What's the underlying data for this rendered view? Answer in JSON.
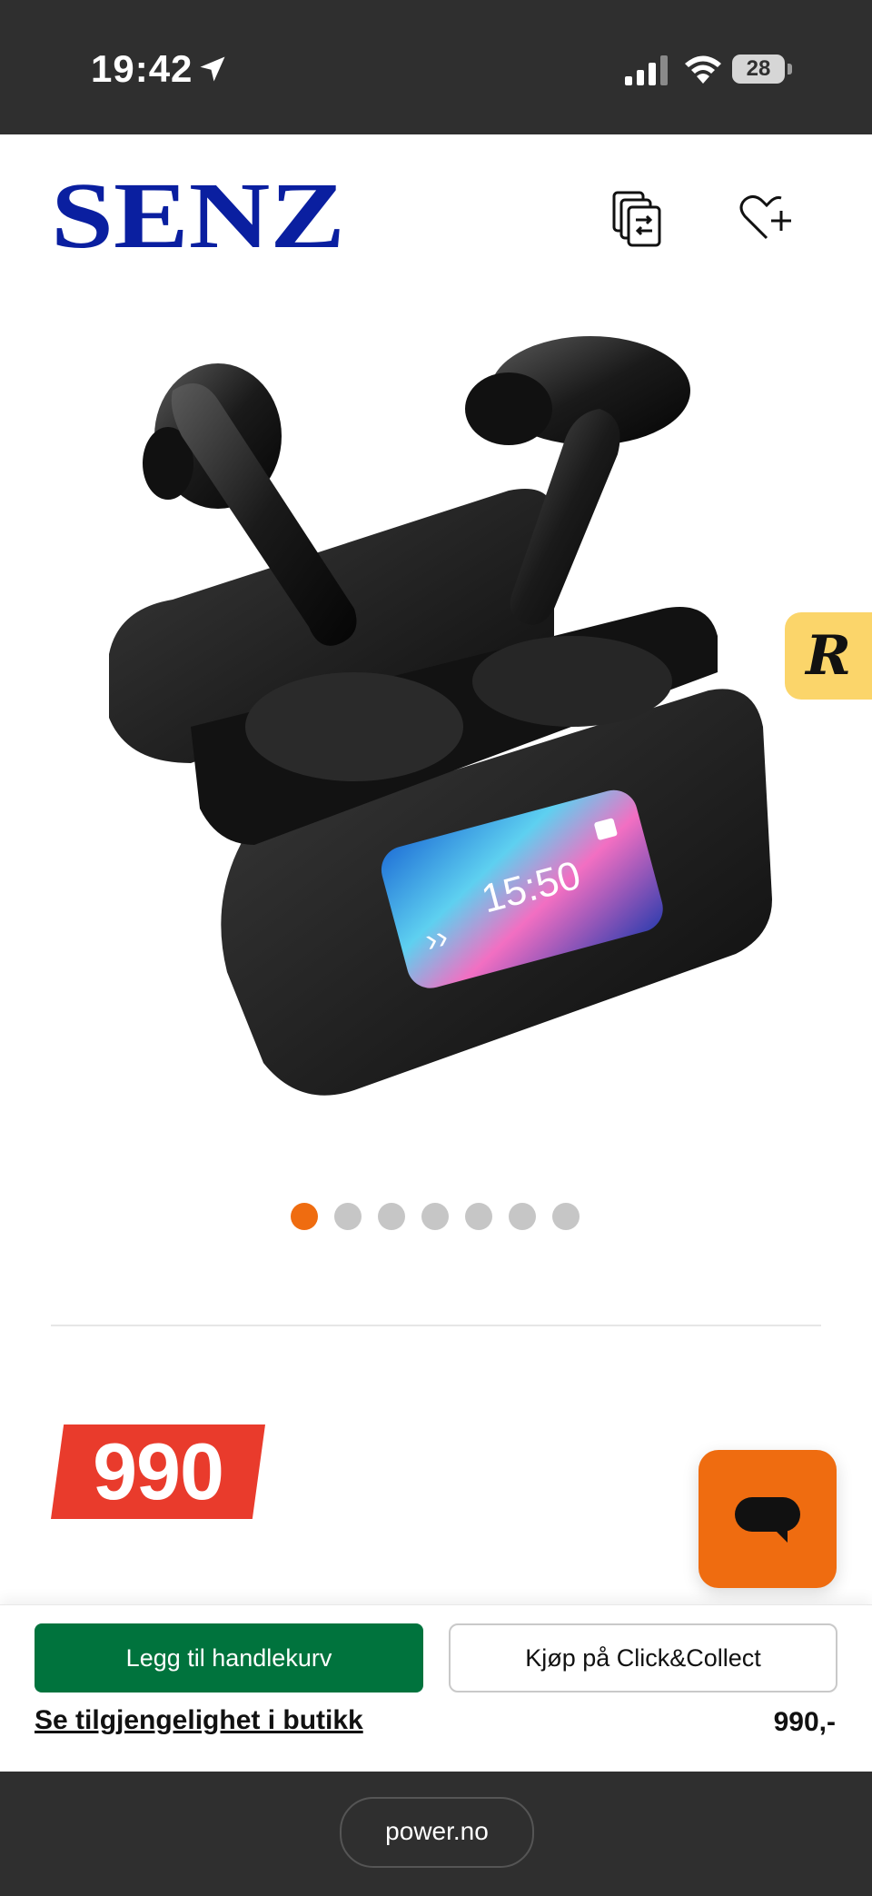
{
  "status_bar": {
    "time": "19:42",
    "battery": "28"
  },
  "header": {
    "brand": "SENZ",
    "brand_color": "#0a1fa0"
  },
  "gallery": {
    "image_count": 7,
    "active_index": 0,
    "screen_time": "15:50"
  },
  "side_badge": {
    "letter": "R"
  },
  "price": {
    "tag": "990",
    "bottom": "990,-"
  },
  "actions": {
    "add_to_cart": "Legg til handlekurv",
    "click_collect": "Kjøp på Click&Collect",
    "availability_link": "Se tilgjengelighet i butikk"
  },
  "browser": {
    "url": "power.no"
  },
  "colors": {
    "accent_orange": "#ef6c10",
    "cart_green": "#00733d",
    "price_red": "#e93b2c",
    "status_bar_bg": "#2f2f2f"
  }
}
